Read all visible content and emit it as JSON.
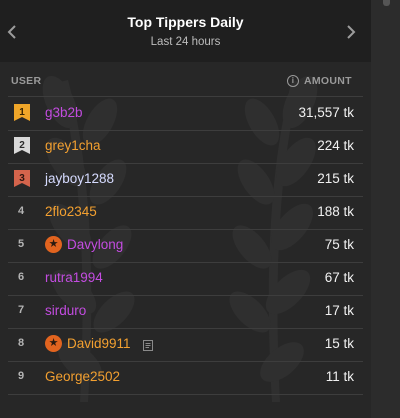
{
  "header": {
    "title": "Top Tippers Daily",
    "subtitle": "Last 24 hours"
  },
  "columns": {
    "user": "USER",
    "amount": "AMOUNT"
  },
  "colors": {
    "purple": "#c34ce0",
    "orange": "#f3a030",
    "lightblue": "#d6dbff",
    "gold": "#f0a629",
    "silver": "#d9d9d9",
    "bronze": "#d4644c"
  },
  "rows": [
    {
      "rank": "1",
      "user": "g3b2b",
      "amount": "31,557 tk"
    },
    {
      "rank": "2",
      "user": "grey1cha",
      "amount": "224 tk"
    },
    {
      "rank": "3",
      "user": "jayboy1288",
      "amount": "215 tk"
    },
    {
      "rank": "4",
      "user": "2flo2345",
      "amount": "188 tk"
    },
    {
      "rank": "5",
      "user": "Davylong",
      "amount": "75 tk"
    },
    {
      "rank": "6",
      "user": "rutra1994",
      "amount": "67 tk"
    },
    {
      "rank": "7",
      "user": "sirduro",
      "amount": "17 tk"
    },
    {
      "rank": "8",
      "user": "David9911",
      "amount": "15 tk"
    },
    {
      "rank": "9",
      "user": "George2502",
      "amount": "11 tk"
    }
  ]
}
